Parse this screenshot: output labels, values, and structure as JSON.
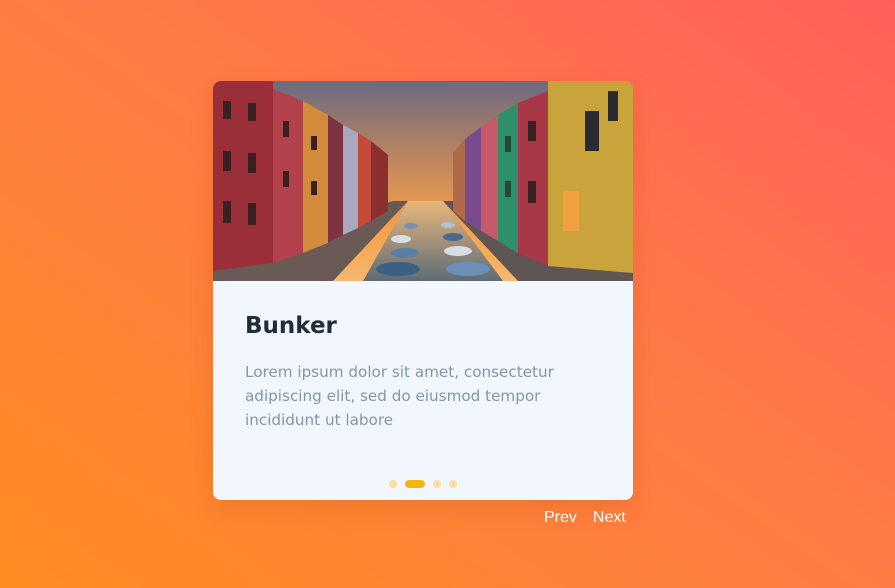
{
  "card": {
    "title": "Bunker",
    "description": "Lorem ipsum dolor sit amet, consectetur adipiscing elit, sed do eiusmod tempor incididunt ut labore"
  },
  "pagination": {
    "count": 4,
    "active_index": 1,
    "active_color": "#f7b512",
    "inactive_color": "#f8dfa2"
  },
  "navigation": {
    "prev_label": "Prev",
    "next_label": "Next"
  },
  "colors": {
    "background_start": "#ff8c22",
    "background_end": "#ff5f5b",
    "card_background": "#f2f7fe",
    "title": "#1f2d3d",
    "body_text": "#8496a8"
  }
}
